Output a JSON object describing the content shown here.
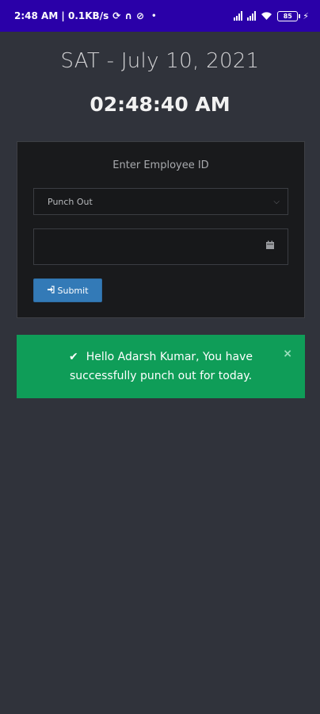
{
  "status_bar": {
    "time_and_speed": "2:48 AM | 0.1KB/s",
    "battery": "85",
    "icons": [
      "sync-icon",
      "headset-icon",
      "block-icon",
      "signal-icon",
      "signal-icon",
      "wifi-icon",
      "battery-icon",
      "bolt-icon"
    ]
  },
  "date_text": "SAT - July 10, 2021",
  "clock_text": "02:48:40 AM",
  "form": {
    "title": "Enter Employee ID",
    "select_value": "Punch Out",
    "submit_label": "Submit"
  },
  "alert": {
    "message": "Hello Adarsh Kumar, You have successfully punch out for today.",
    "close": "×"
  },
  "colors": {
    "status_bar": "#2a00a8",
    "background": "#30333b",
    "card": "#191a1c",
    "button": "#337ab7",
    "success": "#0f9d58"
  }
}
